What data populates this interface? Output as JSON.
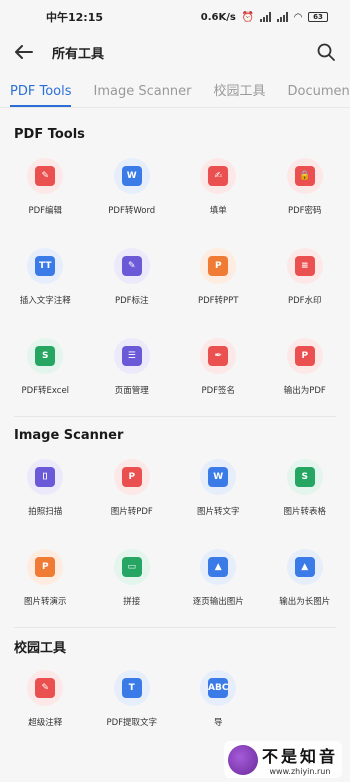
{
  "status": {
    "time": "中午12:15",
    "speed": "0.6K/s",
    "battery": "63"
  },
  "appbar": {
    "title": "所有工具"
  },
  "tabs": [
    {
      "label": "PDF Tools",
      "active": true
    },
    {
      "label": "Image Scanner",
      "active": false
    },
    {
      "label": "校园工具",
      "active": false
    },
    {
      "label": "Document",
      "active": false
    }
  ],
  "sections": [
    {
      "title": "PDF Tools",
      "tools": [
        {
          "label": "PDF编辑",
          "icon": "pdf-edit-icon",
          "bg": "#fde8e8",
          "fg": "#e9504f",
          "glyph": "✎"
        },
        {
          "label": "PDF转Word",
          "icon": "pdf-to-word-icon",
          "bg": "#e6eefc",
          "fg": "#3b7be8",
          "glyph": "W"
        },
        {
          "label": "填单",
          "icon": "fill-form-icon",
          "bg": "#fde8e8",
          "fg": "#e9504f",
          "glyph": "✍"
        },
        {
          "label": "PDF密码",
          "icon": "pdf-lock-icon",
          "bg": "#fde8e8",
          "fg": "#e9504f",
          "glyph": "🔒"
        },
        {
          "label": "插入文字注释",
          "icon": "text-annotation-icon",
          "bg": "#e6eefc",
          "fg": "#3b7be8",
          "glyph": "TT"
        },
        {
          "label": "PDF标注",
          "icon": "pdf-markup-icon",
          "bg": "#ece9fb",
          "fg": "#6a5ad8",
          "glyph": "✎"
        },
        {
          "label": "PDF转PPT",
          "icon": "pdf-to-ppt-icon",
          "bg": "#fdecdf",
          "fg": "#f07b35",
          "glyph": "P"
        },
        {
          "label": "PDF水印",
          "icon": "pdf-watermark-icon",
          "bg": "#fde8e8",
          "fg": "#e9504f",
          "glyph": "≡"
        },
        {
          "label": "PDF转Excel",
          "icon": "pdf-to-excel-icon",
          "bg": "#e3f5ec",
          "fg": "#27a663",
          "glyph": "S"
        },
        {
          "label": "页面管理",
          "icon": "page-manage-icon",
          "bg": "#ece9fb",
          "fg": "#6a5ad8",
          "glyph": "☰"
        },
        {
          "label": "PDF签名",
          "icon": "pdf-sign-icon",
          "bg": "#fde8e8",
          "fg": "#e9504f",
          "glyph": "✒"
        },
        {
          "label": "输出为PDF",
          "icon": "export-pdf-icon",
          "bg": "#fde8e8",
          "fg": "#e9504f",
          "glyph": "P"
        }
      ]
    },
    {
      "title": "Image Scanner",
      "tools": [
        {
          "label": "拍照扫描",
          "icon": "photo-scan-icon",
          "bg": "#ece9fb",
          "fg": "#6a5ad8",
          "glyph": "⌷"
        },
        {
          "label": "图片转PDF",
          "icon": "image-to-pdf-icon",
          "bg": "#fde8e8",
          "fg": "#e9504f",
          "glyph": "P"
        },
        {
          "label": "图片转文字",
          "icon": "image-to-text-icon",
          "bg": "#e6eefc",
          "fg": "#3b7be8",
          "glyph": "W"
        },
        {
          "label": "图片转表格",
          "icon": "image-to-table-icon",
          "bg": "#e3f5ec",
          "fg": "#27a663",
          "glyph": "S"
        },
        {
          "label": "图片转演示",
          "icon": "image-to-slides-icon",
          "bg": "#fdecdf",
          "fg": "#f07b35",
          "glyph": "P"
        },
        {
          "label": "拼接",
          "icon": "stitch-icon",
          "bg": "#e3f5ec",
          "fg": "#27a663",
          "glyph": "▭"
        },
        {
          "label": "逐页输出图片",
          "icon": "export-pages-image-icon",
          "bg": "#e6eefc",
          "fg": "#3b7be8",
          "glyph": "▲"
        },
        {
          "label": "输出为长图片",
          "icon": "export-long-image-icon",
          "bg": "#e6eefc",
          "fg": "#3b7be8",
          "glyph": "▲"
        }
      ]
    },
    {
      "title": "校园工具",
      "tools": [
        {
          "label": "超级注释",
          "icon": "super-annotation-icon",
          "bg": "#fde8e8",
          "fg": "#e9504f",
          "glyph": "✎"
        },
        {
          "label": "PDF提取文字",
          "icon": "pdf-extract-text-icon",
          "bg": "#e6eefc",
          "fg": "#3b7be8",
          "glyph": "T"
        },
        {
          "label": "导",
          "icon": "abc-icon",
          "bg": "#e6eefc",
          "fg": "#3b7be8",
          "glyph": "ABC"
        }
      ]
    }
  ],
  "watermark": {
    "big": "不是知音",
    "small": "www.zhiyin.run"
  }
}
